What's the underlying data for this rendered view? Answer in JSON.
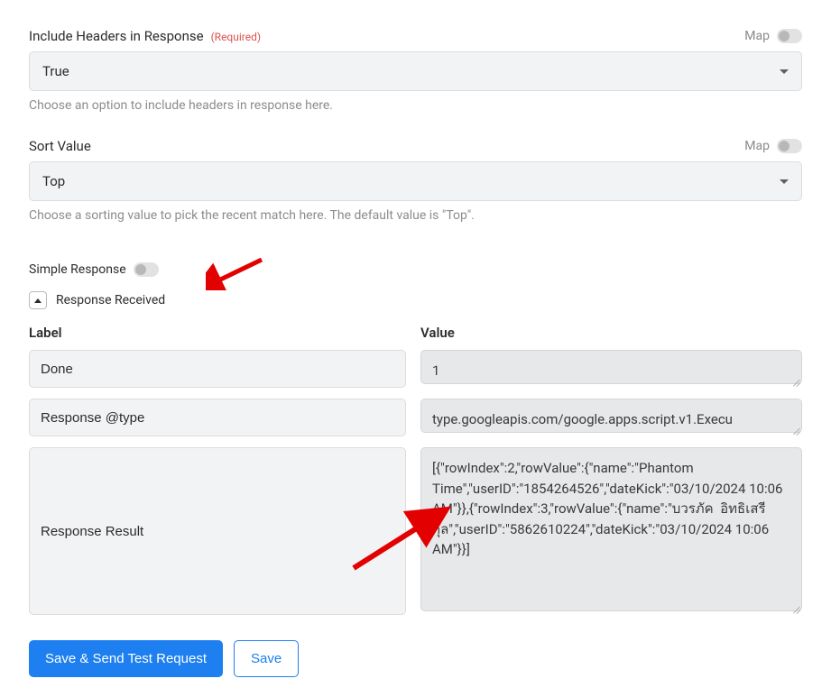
{
  "includeHeaders": {
    "label": "Include Headers in Response",
    "requiredText": "(Required)",
    "value": "True",
    "helper": "Choose an option to include headers in response here.",
    "mapLabel": "Map"
  },
  "sortValue": {
    "label": "Sort Value",
    "value": "Top",
    "helper": "Choose a sorting value to pick the recent match here. The default value is \"Top\".",
    "mapLabel": "Map"
  },
  "simpleResponse": {
    "label": "Simple Response"
  },
  "responseReceived": {
    "label": "Response Received",
    "labelCol": "Label",
    "valueCol": "Value",
    "rows": [
      {
        "label": "Done",
        "value": "1"
      },
      {
        "label": "Response @type",
        "value": "type.googleapis.com/google.apps.script.v1.Execu"
      },
      {
        "label": "Response Result",
        "value": "[{\"rowIndex\":2,\"rowValue\":{\"name\":\"Phantom Time\",\"userID\":\"1854264526\",\"dateKick\":\"03/10/2024 10:06 AM\"}},{\"rowIndex\":3,\"rowValue\":{\"name\":\"บวรภัค  อิทธิเสรีกุล\",\"userID\":\"5862610224\",\"dateKick\":\"03/10/2024 10:06 AM\"}}]"
      }
    ]
  },
  "buttons": {
    "primary": "Save & Send Test Request",
    "secondary": "Save"
  }
}
